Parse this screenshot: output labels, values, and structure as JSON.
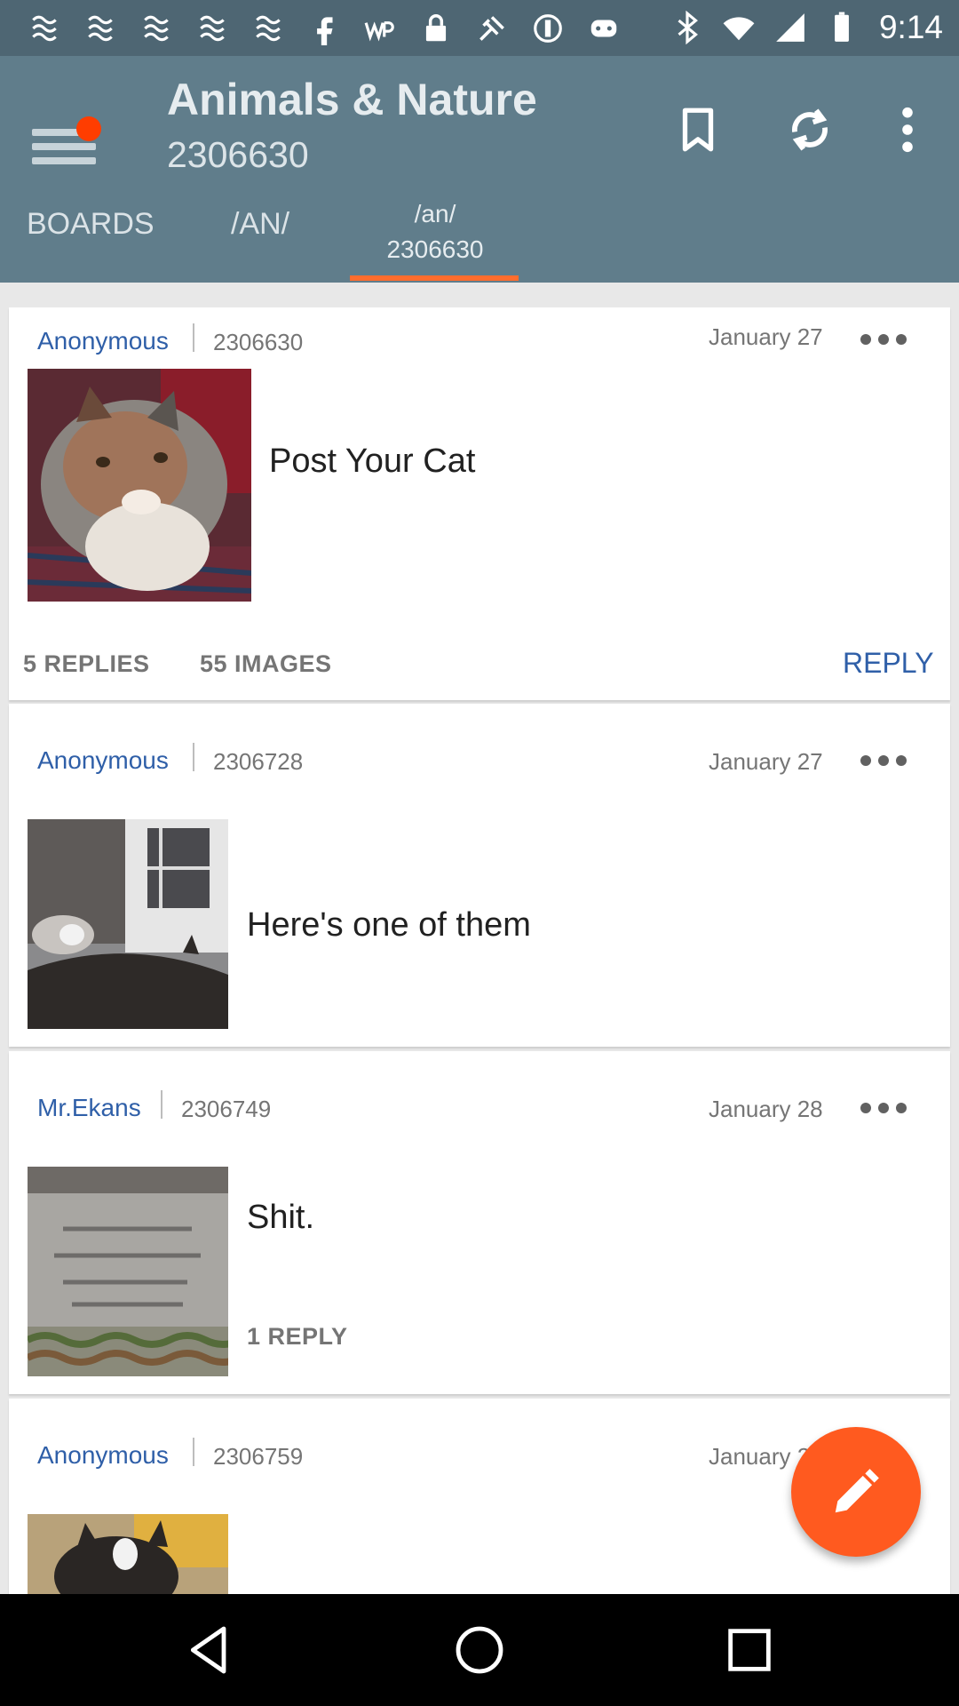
{
  "status_bar": {
    "time": "9:14",
    "left_icons": [
      "notification-icon",
      "notification-icon",
      "notification-icon",
      "notification-icon",
      "notification-icon",
      "facebook-icon",
      "wordpress-icon",
      "lock-icon",
      "fake-gps-icon",
      "circle-icon",
      "game-controller-icon"
    ],
    "right_icons": [
      "bluetooth-icon",
      "wifi-icon",
      "signal-icon",
      "battery-icon"
    ]
  },
  "app_bar": {
    "title": "Animals & Nature",
    "subtitle": "2306630",
    "tabs": [
      {
        "label": "BOARDS"
      },
      {
        "label": "/AN/"
      },
      {
        "label": "/an/",
        "label2": "2306630"
      }
    ]
  },
  "posts": [
    {
      "author": "Anonymous",
      "number": "2306630",
      "date": "January 27",
      "comment": "Post Your Cat",
      "replies": "5 REPLIES",
      "images": "55 IMAGES",
      "reply_label": "REPLY"
    },
    {
      "author": "Anonymous",
      "number": "2306728",
      "date": "January 27",
      "comment": "Here's one of them"
    },
    {
      "author": "Mr.Ekans",
      "number": "2306749",
      "date": "January 28",
      "comment": "Shit.",
      "replies": "1 REPLY"
    },
    {
      "author": "Anonymous",
      "number": "2306759",
      "date": "January 2"
    }
  ],
  "colors": {
    "status_bar": "#4e6673",
    "app_bar": "#607d8b",
    "accent": "#ff5a1f",
    "link": "#2f5fa8"
  }
}
